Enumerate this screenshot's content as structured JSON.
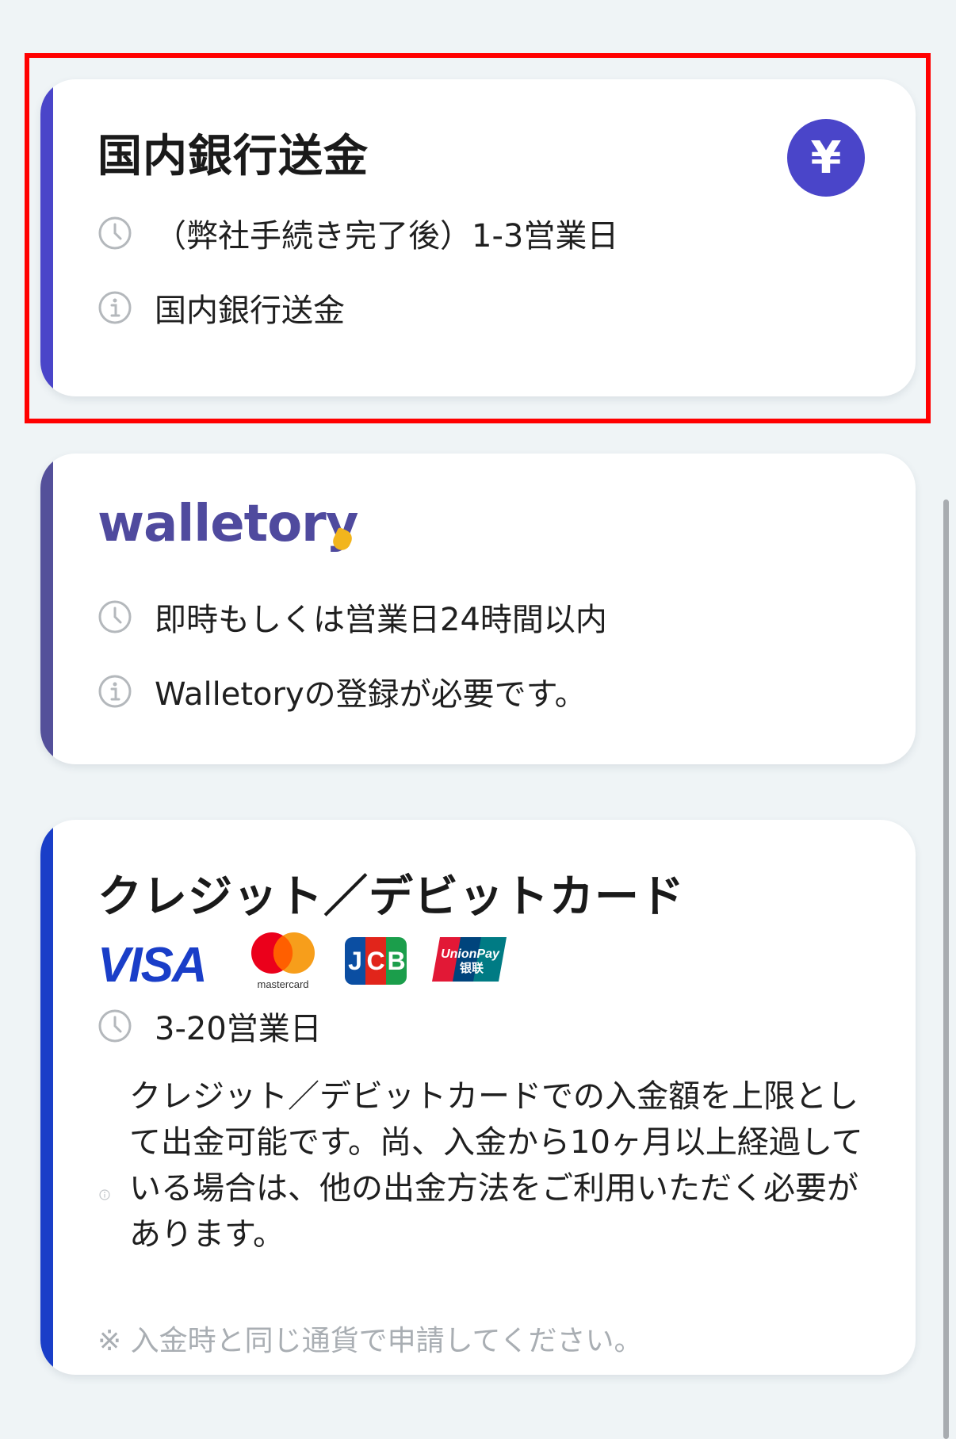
{
  "cards": {
    "bank": {
      "title": "国内銀行送金",
      "icon": "yen-icon",
      "icon_glyph": "¥",
      "accent_color": "#4a45c9",
      "time_text": "（弊社手続き完了後）1-3営業日",
      "info_text": "国内銀行送金"
    },
    "walletory": {
      "brand": "walletory",
      "accent_color": "#54509a",
      "time_text": "即時もしくは営業日24時間以内",
      "info_text": "Walletoryの登録が必要です。"
    },
    "card": {
      "title": "クレジット／デビットカード",
      "accent_color": "#1a3ec8",
      "logos": {
        "visa": "VISA",
        "mastercard": "mastercard",
        "jcb": [
          "J",
          "C",
          "B"
        ],
        "unionpay": [
          "UnionPay",
          "银联"
        ]
      },
      "time_text": "3-20営業日",
      "description": "クレジット／デビットカードでの入金額を上限として出金可能です。尚、入金から10ヶ月以上経過している場合は、他の出金方法をご利用いただく必要があります。",
      "note": "※ 入金時と同じ通貨で申請してください。"
    }
  },
  "highlight_color": "#ff0000"
}
